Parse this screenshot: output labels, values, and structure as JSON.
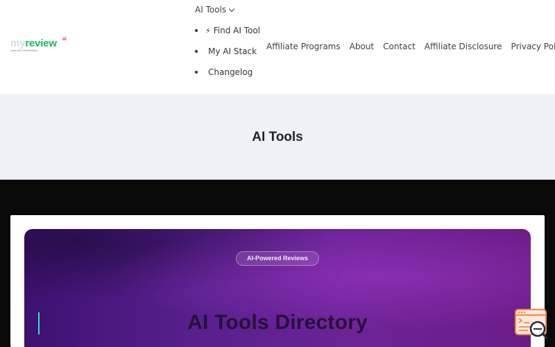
{
  "logo": {
    "my": "my",
    "review": "review",
    "ai": "ai",
    "tagline": "Learn all & Find Reviews"
  },
  "dropdown": {
    "label": "AI Tools",
    "items": [
      {
        "glyph": "⚡",
        "label": "Find AI Tool"
      },
      {
        "glyph": "",
        "label": "My AI Stack"
      },
      {
        "glyph": "",
        "label": "Changelog"
      }
    ]
  },
  "nav": {
    "items": [
      {
        "glyph": "",
        "label": "Affiliate Programs"
      },
      {
        "glyph": "",
        "label": "About"
      },
      {
        "glyph": "",
        "label": "Contact"
      },
      {
        "glyph": "",
        "label": "Affiliate Disclosure"
      },
      {
        "glyph": "",
        "label": "Privacy Policy"
      }
    ]
  },
  "hero": {
    "title": "AI Tools"
  },
  "banner": {
    "badge": "AI-Powered Reviews",
    "title": "AI Tools Directory"
  },
  "colors": {
    "accent_green": "#23b45c",
    "accent_teal": "#2ee6c3",
    "banner_purple": "#58208e",
    "widget_orange": "#f08a4b",
    "widget_navy": "#1f2a44"
  },
  "icons": {
    "dropdown_chevron": "chevron-down-icon",
    "widget": "terminal-search-icon"
  }
}
